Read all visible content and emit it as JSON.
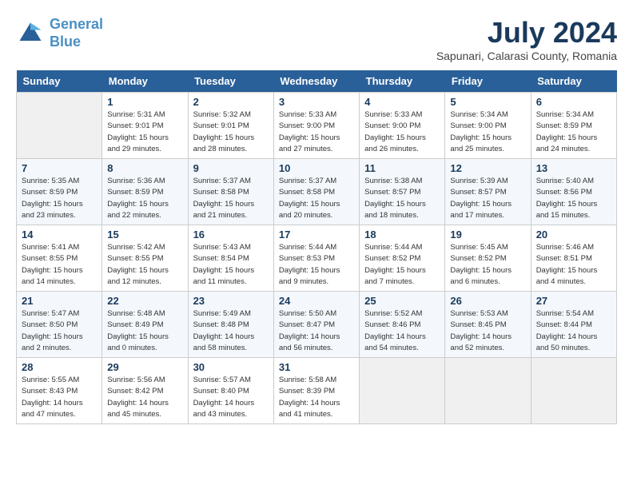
{
  "header": {
    "logo_line1": "General",
    "logo_line2": "Blue",
    "month": "July 2024",
    "location": "Sapunari, Calarasi County, Romania"
  },
  "weekdays": [
    "Sunday",
    "Monday",
    "Tuesday",
    "Wednesday",
    "Thursday",
    "Friday",
    "Saturday"
  ],
  "weeks": [
    [
      {
        "day": "",
        "info": ""
      },
      {
        "day": "1",
        "info": "Sunrise: 5:31 AM\nSunset: 9:01 PM\nDaylight: 15 hours\nand 29 minutes."
      },
      {
        "day": "2",
        "info": "Sunrise: 5:32 AM\nSunset: 9:01 PM\nDaylight: 15 hours\nand 28 minutes."
      },
      {
        "day": "3",
        "info": "Sunrise: 5:33 AM\nSunset: 9:00 PM\nDaylight: 15 hours\nand 27 minutes."
      },
      {
        "day": "4",
        "info": "Sunrise: 5:33 AM\nSunset: 9:00 PM\nDaylight: 15 hours\nand 26 minutes."
      },
      {
        "day": "5",
        "info": "Sunrise: 5:34 AM\nSunset: 9:00 PM\nDaylight: 15 hours\nand 25 minutes."
      },
      {
        "day": "6",
        "info": "Sunrise: 5:34 AM\nSunset: 8:59 PM\nDaylight: 15 hours\nand 24 minutes."
      }
    ],
    [
      {
        "day": "7",
        "info": "Sunrise: 5:35 AM\nSunset: 8:59 PM\nDaylight: 15 hours\nand 23 minutes."
      },
      {
        "day": "8",
        "info": "Sunrise: 5:36 AM\nSunset: 8:59 PM\nDaylight: 15 hours\nand 22 minutes."
      },
      {
        "day": "9",
        "info": "Sunrise: 5:37 AM\nSunset: 8:58 PM\nDaylight: 15 hours\nand 21 minutes."
      },
      {
        "day": "10",
        "info": "Sunrise: 5:37 AM\nSunset: 8:58 PM\nDaylight: 15 hours\nand 20 minutes."
      },
      {
        "day": "11",
        "info": "Sunrise: 5:38 AM\nSunset: 8:57 PM\nDaylight: 15 hours\nand 18 minutes."
      },
      {
        "day": "12",
        "info": "Sunrise: 5:39 AM\nSunset: 8:57 PM\nDaylight: 15 hours\nand 17 minutes."
      },
      {
        "day": "13",
        "info": "Sunrise: 5:40 AM\nSunset: 8:56 PM\nDaylight: 15 hours\nand 15 minutes."
      }
    ],
    [
      {
        "day": "14",
        "info": "Sunrise: 5:41 AM\nSunset: 8:55 PM\nDaylight: 15 hours\nand 14 minutes."
      },
      {
        "day": "15",
        "info": "Sunrise: 5:42 AM\nSunset: 8:55 PM\nDaylight: 15 hours\nand 12 minutes."
      },
      {
        "day": "16",
        "info": "Sunrise: 5:43 AM\nSunset: 8:54 PM\nDaylight: 15 hours\nand 11 minutes."
      },
      {
        "day": "17",
        "info": "Sunrise: 5:44 AM\nSunset: 8:53 PM\nDaylight: 15 hours\nand 9 minutes."
      },
      {
        "day": "18",
        "info": "Sunrise: 5:44 AM\nSunset: 8:52 PM\nDaylight: 15 hours\nand 7 minutes."
      },
      {
        "day": "19",
        "info": "Sunrise: 5:45 AM\nSunset: 8:52 PM\nDaylight: 15 hours\nand 6 minutes."
      },
      {
        "day": "20",
        "info": "Sunrise: 5:46 AM\nSunset: 8:51 PM\nDaylight: 15 hours\nand 4 minutes."
      }
    ],
    [
      {
        "day": "21",
        "info": "Sunrise: 5:47 AM\nSunset: 8:50 PM\nDaylight: 15 hours\nand 2 minutes."
      },
      {
        "day": "22",
        "info": "Sunrise: 5:48 AM\nSunset: 8:49 PM\nDaylight: 15 hours\nand 0 minutes."
      },
      {
        "day": "23",
        "info": "Sunrise: 5:49 AM\nSunset: 8:48 PM\nDaylight: 14 hours\nand 58 minutes."
      },
      {
        "day": "24",
        "info": "Sunrise: 5:50 AM\nSunset: 8:47 PM\nDaylight: 14 hours\nand 56 minutes."
      },
      {
        "day": "25",
        "info": "Sunrise: 5:52 AM\nSunset: 8:46 PM\nDaylight: 14 hours\nand 54 minutes."
      },
      {
        "day": "26",
        "info": "Sunrise: 5:53 AM\nSunset: 8:45 PM\nDaylight: 14 hours\nand 52 minutes."
      },
      {
        "day": "27",
        "info": "Sunrise: 5:54 AM\nSunset: 8:44 PM\nDaylight: 14 hours\nand 50 minutes."
      }
    ],
    [
      {
        "day": "28",
        "info": "Sunrise: 5:55 AM\nSunset: 8:43 PM\nDaylight: 14 hours\nand 47 minutes."
      },
      {
        "day": "29",
        "info": "Sunrise: 5:56 AM\nSunset: 8:42 PM\nDaylight: 14 hours\nand 45 minutes."
      },
      {
        "day": "30",
        "info": "Sunrise: 5:57 AM\nSunset: 8:40 PM\nDaylight: 14 hours\nand 43 minutes."
      },
      {
        "day": "31",
        "info": "Sunrise: 5:58 AM\nSunset: 8:39 PM\nDaylight: 14 hours\nand 41 minutes."
      },
      {
        "day": "",
        "info": ""
      },
      {
        "day": "",
        "info": ""
      },
      {
        "day": "",
        "info": ""
      }
    ]
  ]
}
